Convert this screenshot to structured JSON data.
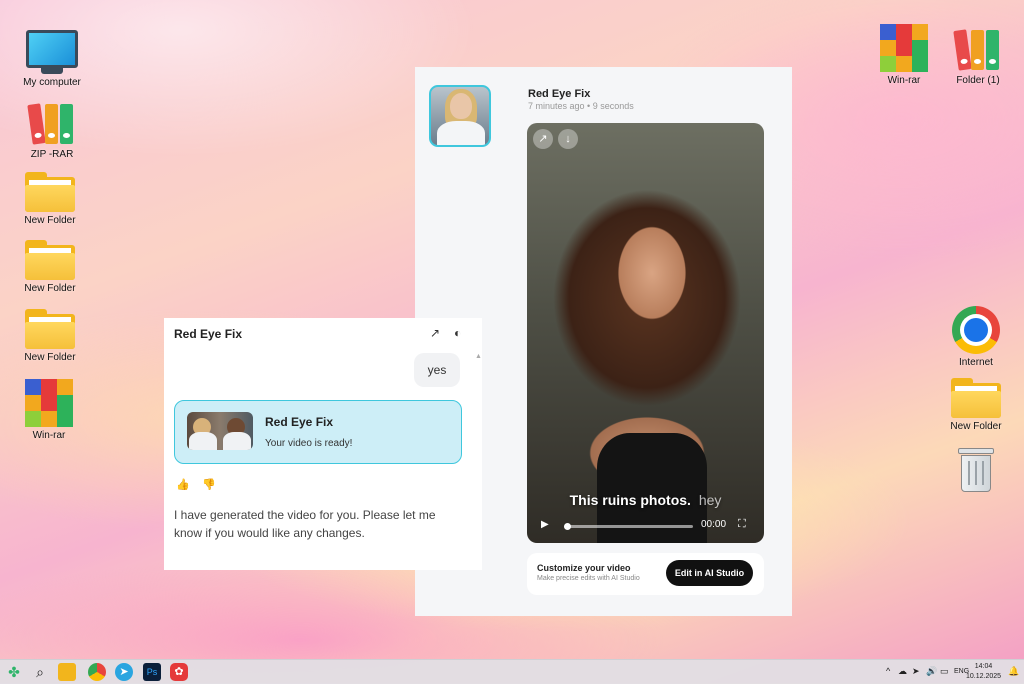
{
  "desktop": {
    "left_icons": [
      {
        "label": "My computer",
        "icon": "computer-icon"
      },
      {
        "label": "ZIP -RAR",
        "icon": "binders-icon"
      },
      {
        "label": "New Folder",
        "icon": "folder-icon"
      },
      {
        "label": "New Folder",
        "icon": "folder-icon"
      },
      {
        "label": "New Folder",
        "icon": "folder-icon"
      },
      {
        "label": "Win-rar",
        "icon": "winrar-icon"
      }
    ],
    "right_icons": [
      {
        "label": "Win-rar",
        "icon": "winrar-icon"
      },
      {
        "label": "Folder (1)",
        "icon": "binders-icon"
      },
      {
        "label": "Internet",
        "icon": "chrome-icon"
      },
      {
        "label": "New Folder",
        "icon": "folder-icon"
      },
      {
        "label": "",
        "icon": "recycle-bin-icon"
      }
    ]
  },
  "video_panel": {
    "title": "Red Eye Fix",
    "meta": "7 minutes ago • 9 seconds",
    "share_icon": "↗",
    "download_icon": "↓",
    "caption": "This ruins photos.",
    "watermark": "hey",
    "time": "00:00",
    "play_icon": "▶",
    "fullscreen_icon": "⛶",
    "customize_title": "Customize your video",
    "customize_sub": "Make precise edits with AI Studio",
    "edit_button": "Edit in AI Studio"
  },
  "chat": {
    "title": "Red Eye Fix",
    "open_icon": "↗",
    "globe_icon": "◐",
    "user_message": "yes",
    "scroll_up_icon": "▲",
    "card_title": "Red Eye Fix",
    "card_subtitle": "Your video is ready!",
    "thumb_up_icon": "👍",
    "thumb_down_icon": "👎",
    "reply": "I have generated the video for you. Please let me know if you would like any changes."
  },
  "taskbar": {
    "language": "ENG",
    "time": "14:04",
    "date": "10.12.2025"
  },
  "colors": {
    "accent_cyan": "#3fc7dd",
    "card_bg": "#cdeef7",
    "button_dark": "#111111"
  }
}
